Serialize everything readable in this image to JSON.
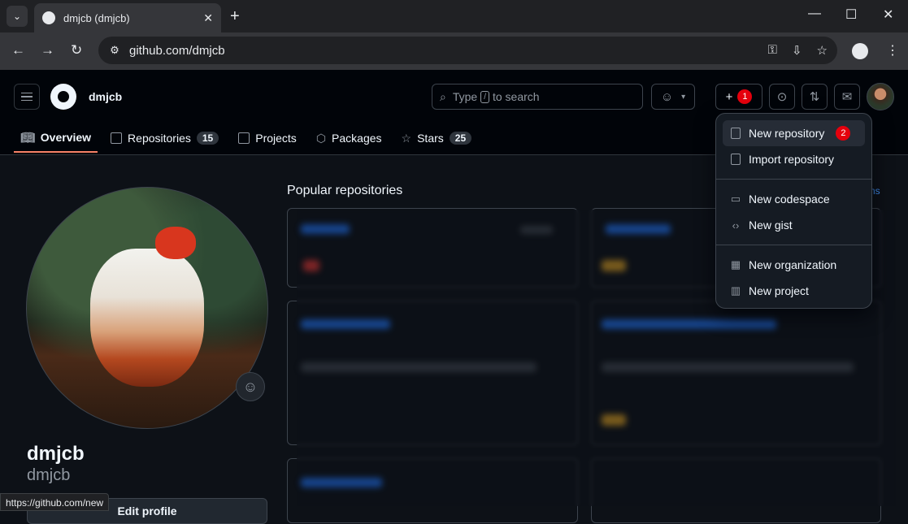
{
  "browser": {
    "tab_title": "dmjcb (dmjcb)",
    "url": "github.com/dmjcb",
    "status_url": "https://github.com/new"
  },
  "header": {
    "username": "dmjcb",
    "search_prefix": "Type",
    "search_key": "/",
    "search_suffix": "to search",
    "create_badge": "1"
  },
  "subnav": {
    "items": [
      {
        "label": "Overview",
        "count": ""
      },
      {
        "label": "Repositories",
        "count": "15"
      },
      {
        "label": "Projects",
        "count": ""
      },
      {
        "label": "Packages",
        "count": ""
      },
      {
        "label": "Stars",
        "count": "25"
      }
    ]
  },
  "profile": {
    "name": "dmjcb",
    "login": "dmjcb",
    "edit_label": "Edit profile"
  },
  "main": {
    "popular_title": "Popular repositories",
    "customize_fragment": "ns"
  },
  "create_menu": {
    "items": [
      {
        "label": "New repository",
        "badge": "2",
        "icon": "repo-icon"
      },
      {
        "label": "Import repository",
        "icon": "repo-push-icon"
      },
      {
        "label": "New codespace",
        "icon": "codespaces-icon"
      },
      {
        "label": "New gist",
        "icon": "code-icon"
      },
      {
        "label": "New organization",
        "icon": "organization-icon"
      },
      {
        "label": "New project",
        "icon": "project-icon"
      }
    ]
  },
  "colors": {
    "accent_underline": "#f78166",
    "badge_red": "#e5000d",
    "link_blue": "#4493f8"
  }
}
